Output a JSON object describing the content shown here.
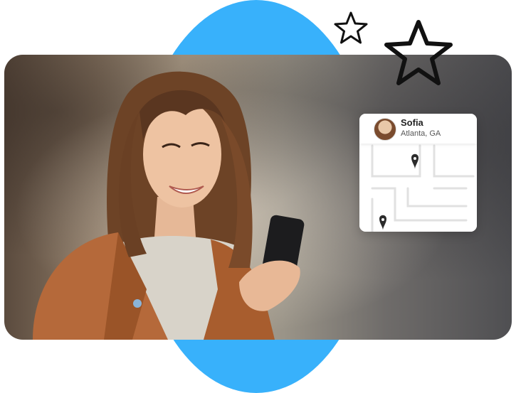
{
  "map_card": {
    "name": "Sofia",
    "location": "Atlanta, GA"
  },
  "icons": {
    "star_small": "star-outline-icon",
    "star_large": "star-outline-icon",
    "pin": "map-pin-icon"
  },
  "colors": {
    "accent_blue": "#38b1fb"
  }
}
